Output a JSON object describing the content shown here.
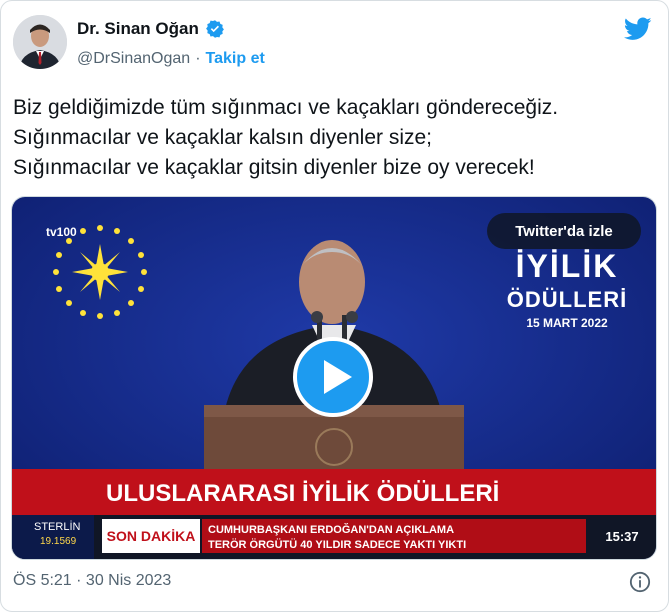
{
  "author": {
    "name": "Dr. Sinan Oğan",
    "handle": "@DrSinanOgan",
    "separator": "·",
    "follow_label": "Takip et"
  },
  "tweet": {
    "lines": [
      "Biz geldiğimizde tüm sığınmacı ve kaçakları göndereceğiz.",
      "Sığınmacılar ve kaçaklar kalsın diyenler size;",
      "Sığınmacılar ve kaçaklar gitsin diyenler bize oy verecek!"
    ]
  },
  "video": {
    "watch_label": "Twitter'da izle",
    "channel_logo": "tv100",
    "event_title_line1": "İYİLİK",
    "event_title_line2": "ÖDÜLLERİ",
    "event_date": "15 MART 2022",
    "banner_title": "ULUSLARARASI İYİLİK ÖDÜLLERİ",
    "ticker_label": "STERLİN",
    "ticker_value": "19.1569",
    "breaking_label": "SON DAKİKA",
    "breaking_line1": "CUMHURBAŞKANI ERDOĞAN'DAN AÇIKLAMA",
    "breaking_line2": "TERÖR ÖRGÜTÜ 40 YILDIR SADECE YAKTI YIKTI",
    "clock": "15:37"
  },
  "footer": {
    "timestamp": "ÖS 5:21 · 30 Nis 2023"
  },
  "icons": {
    "verified": "verified-badge-icon",
    "twitter": "twitter-bird-icon",
    "play": "play-icon",
    "info": "info-icon"
  },
  "colors": {
    "accent": "#1d9bf0",
    "text": "#0f1419",
    "muted": "#536471",
    "video_bg": "#14288a",
    "banner_red": "#c0101a"
  }
}
